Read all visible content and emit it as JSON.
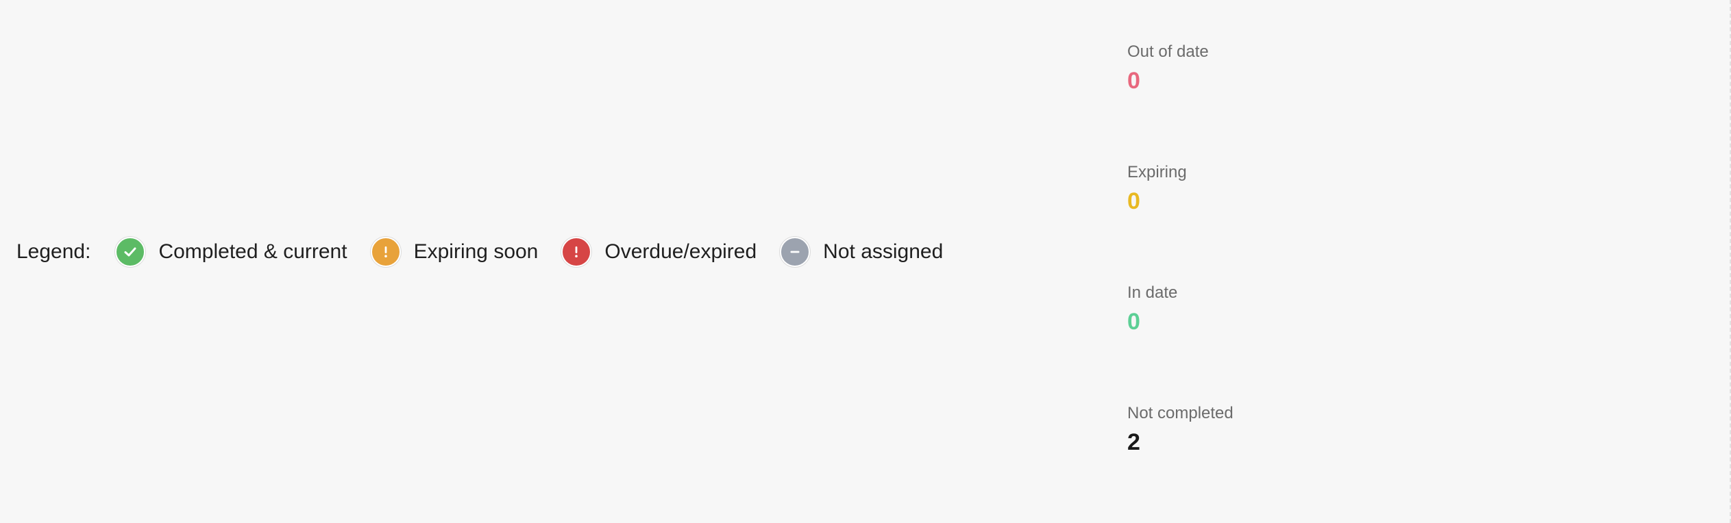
{
  "legend": {
    "title": "Legend:",
    "items": [
      {
        "label": "Completed & current",
        "icon": "check-circle-icon",
        "color": "#5cbb65"
      },
      {
        "label": "Expiring soon",
        "icon": "warning-circle-icon",
        "color": "#e8a23a"
      },
      {
        "label": "Overdue/expired",
        "icon": "alert-circle-icon",
        "color": "#d64545"
      },
      {
        "label": "Not assigned",
        "icon": "minus-circle-icon",
        "color": "#9ca3af"
      }
    ]
  },
  "stats": [
    {
      "label": "Out of date",
      "value": "0",
      "color": "#e8687e"
    },
    {
      "label": "Expiring",
      "value": "0",
      "color": "#e8b923"
    },
    {
      "label": "In date",
      "value": "0",
      "color": "#5ccf95"
    },
    {
      "label": "Not completed",
      "value": "2",
      "color": "#1a1a1a"
    }
  ]
}
